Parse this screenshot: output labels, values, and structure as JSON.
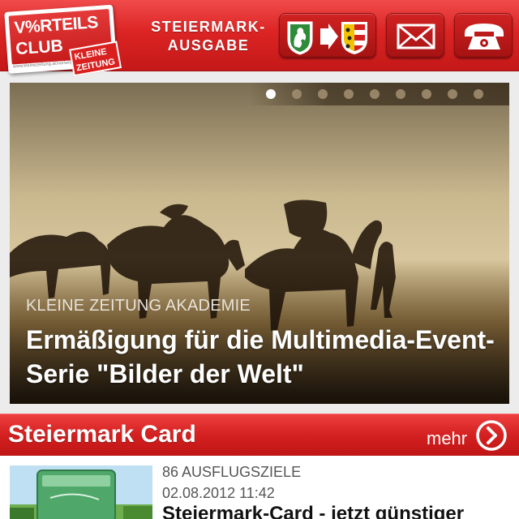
{
  "header": {
    "logo": {
      "line1": "V%RTEILS",
      "line2": "CLUB",
      "badge_line1": "KLEINE",
      "badge_line2": "ZEITUNG",
      "url": "www.kleinezeitung.at/vorteilsclub"
    },
    "edition_line1": "STEIERMARK-",
    "edition_line2": "AUSGABE",
    "buttons": [
      {
        "name": "region-switch",
        "icon": "coat-of-arms-arrow-icon"
      },
      {
        "name": "mail",
        "icon": "envelope-icon"
      },
      {
        "name": "phone",
        "icon": "telephone-icon"
      }
    ]
  },
  "slider": {
    "dot_count": 9,
    "active_index": 0,
    "kicker": "KLEINE ZEITUNG AKADEMIE",
    "title": "Ermäßigung für die Multimedia-Event-Serie \"Bilder der Welt\""
  },
  "section": {
    "title": "Steiermark Card",
    "more_label": "mehr"
  },
  "article": {
    "kicker": "86 AUSFLUGSZIELE",
    "date": "02.08.2012 11:42",
    "title": "Steiermark-Card - jetzt günstiger"
  },
  "colors": {
    "brand_red": "#d42020",
    "header_text": "#ffffff",
    "meta_text": "#555555"
  }
}
